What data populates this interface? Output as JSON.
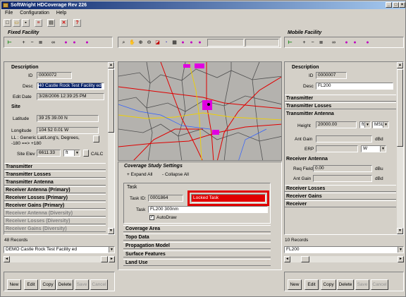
{
  "window": {
    "title": "SoftWright HDCoverage Rev 226",
    "min": "_",
    "max": "□",
    "close": "×"
  },
  "menu": [
    "File",
    "Configuration",
    "Help"
  ],
  "toolbar_icons": [
    "new-icon",
    "open-icon",
    "save-icon",
    "edit-icon",
    "print-icon",
    "delete-icon",
    "help-icon"
  ],
  "fixed_facility": {
    "header": "Fixed Facility",
    "description_header": "Description",
    "id_label": "ID",
    "id_value": "0000072",
    "desc_label": "Desc",
    "desc_value": "40 Castle Rock Test Facility ed",
    "edit_date_label": "Edit Date",
    "edit_date_value": "3/28/2006 12:39:25 PM",
    "site_header": "Site",
    "latitude_label": "Latitude",
    "latitude_value": "39 25 39.00 N",
    "longitude_label": "Longitude",
    "longitude_value": "104 52 0.01 W",
    "ll_label": "LL : Generic Lat/Long's, Degrees,",
    "ll_label2": "-180 ==> +180",
    "site_elev_label": "Site Elev",
    "site_elev_value": "6611.33",
    "site_elev_unit": "ft",
    "calc_label": "CALC",
    "sections": [
      "Transmitter",
      "Transmitter Losses",
      "Transmitter Antenna",
      "Receiver Antenna (Primary)",
      "Receiver Losses (Primary)",
      "Receiver Gains (Primary)",
      "Receiver Antenna (Diversity)",
      "Receiver Losses (Diversity)",
      "Receiver Gains (Diversity)"
    ],
    "records": "48 Records",
    "selected_record": "DEMO Castle Rock Test Facility ed",
    "buttons": [
      "New",
      "Edit",
      "Copy",
      "Delete",
      "Save",
      "Cancel"
    ]
  },
  "mobile_facility": {
    "header": "Mobile Facility",
    "description_header": "Description",
    "id_label": "ID",
    "id_value": "0000007",
    "desc_label": "Desc",
    "desc_value": "FL200",
    "sections_top": [
      "Transmitter",
      "Transmitter Losses"
    ],
    "tx_antenna_header": "Transmitter Antenna",
    "height_label": "Height",
    "height_value": "20000.00",
    "height_unit": "ft",
    "height_ref": "MSL",
    "ant_gain_label": "Ant Gain",
    "ant_gain_unit": "dBd",
    "erp_label": "ERP",
    "erp_unit": "W",
    "rx_antenna_header": "Receiver Antenna",
    "req_field_label": "Req Field",
    "req_field_value": "0.00",
    "req_field_unit": "dBu",
    "rx_ant_gain_label": "Ant Gain",
    "rx_ant_gain_unit": "dBd",
    "sections_bottom": [
      "Receiver Losses",
      "Receiver Gains",
      "Receiver"
    ],
    "records": "10 Records",
    "selected_record": "FL200",
    "buttons": [
      "New",
      "Edit",
      "Copy",
      "Delete",
      "Save",
      "Cancel"
    ]
  },
  "coverage": {
    "header": "Coverage Study Settings",
    "expand_all": "Expand All",
    "collapse_all": "Collapse All",
    "task_header": "Task",
    "task_id_label": "Task ID:",
    "task_id_value": "0001864",
    "locked_label": "Locked Task",
    "task_label": "Task",
    "task_value": "FL200 300nm",
    "autodraw_label": "AutoDraw",
    "categories": [
      "Coverage Area",
      "Topo Data",
      "Propagation Model",
      "Surface Features",
      "Land Use"
    ]
  },
  "colors": {
    "locked": "#e00000",
    "highlight": "#e00000",
    "title_start": "#0a246a",
    "title_end": "#a6caf0"
  }
}
